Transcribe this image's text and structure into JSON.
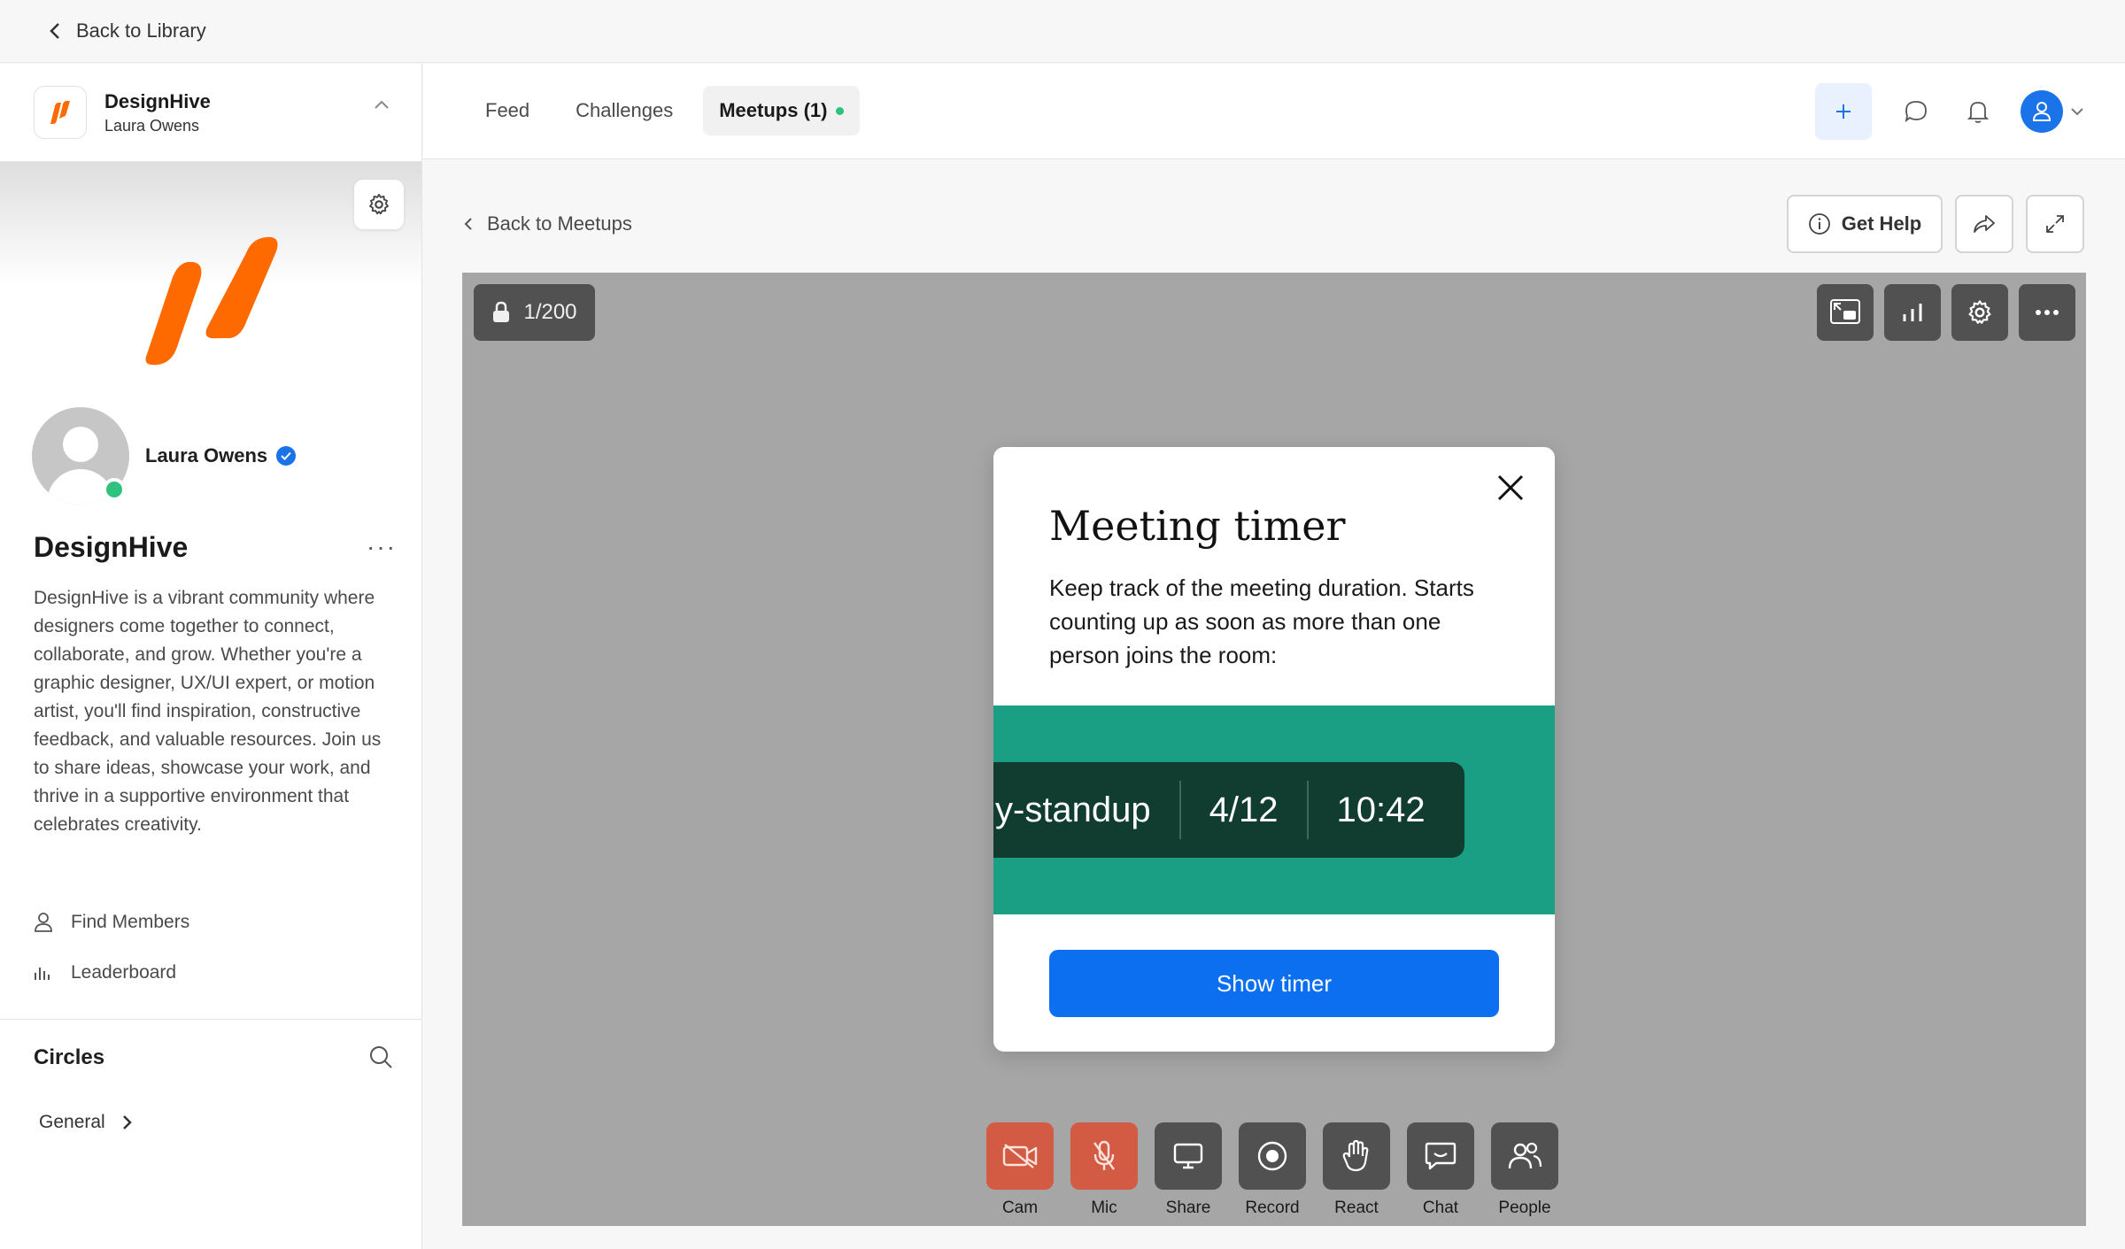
{
  "topbar": {
    "back_label": "Back to Library"
  },
  "community": {
    "name": "DesignHive",
    "owner": "Laura Owens",
    "brand_color": "#ff6a00"
  },
  "profile": {
    "name": "Laura Owens",
    "status_color": "#2ec27e",
    "verified_color": "#1a73e8"
  },
  "sidebar": {
    "title": "DesignHive",
    "more_label": "···",
    "description": "DesignHive is a vibrant community where designers come together to connect, collaborate, and grow. Whether you're a graphic designer, UX/UI expert, or motion artist, you'll find inspiration, constructive feedback, and valuable resources. Join us to share ideas, showcase your work, and thrive in a supportive environment that celebrates creativity.",
    "links": [
      {
        "label": "Find Members",
        "icon": "person-icon"
      },
      {
        "label": "Leaderboard",
        "icon": "bar-chart-icon"
      }
    ],
    "circles_title": "Circles",
    "circles": [
      {
        "label": "General"
      }
    ]
  },
  "header": {
    "tabs": [
      {
        "label": "Feed",
        "active": false
      },
      {
        "label": "Challenges",
        "active": false
      },
      {
        "label": "Meetups (1)",
        "active": true
      }
    ],
    "accent_color": "#1a73e8"
  },
  "content": {
    "back_label": "Back to Meetups",
    "get_help_label": "Get Help"
  },
  "video": {
    "participants": "1/200",
    "background": "#a6a6a6"
  },
  "modal": {
    "title": "Meeting timer",
    "text": "Keep track of the meeting duration. Starts counting up as soon as more than one person joins the room:",
    "timer_name": "y-standup",
    "timer_count": "4/12",
    "timer_time": "10:42",
    "button_label": "Show timer",
    "band_color": "#1a9e84",
    "button_color": "#0b6ff0"
  },
  "controls": [
    {
      "label": "Cam",
      "icon": "camera-off-icon",
      "state": "off"
    },
    {
      "label": "Mic",
      "icon": "mic-off-icon",
      "state": "off"
    },
    {
      "label": "Share",
      "icon": "screen-share-icon",
      "state": "normal"
    },
    {
      "label": "Record",
      "icon": "record-icon",
      "state": "normal"
    },
    {
      "label": "React",
      "icon": "hand-icon",
      "state": "normal"
    },
    {
      "label": "Chat",
      "icon": "chat-icon",
      "state": "normal"
    },
    {
      "label": "People",
      "icon": "people-icon",
      "state": "normal"
    }
  ]
}
